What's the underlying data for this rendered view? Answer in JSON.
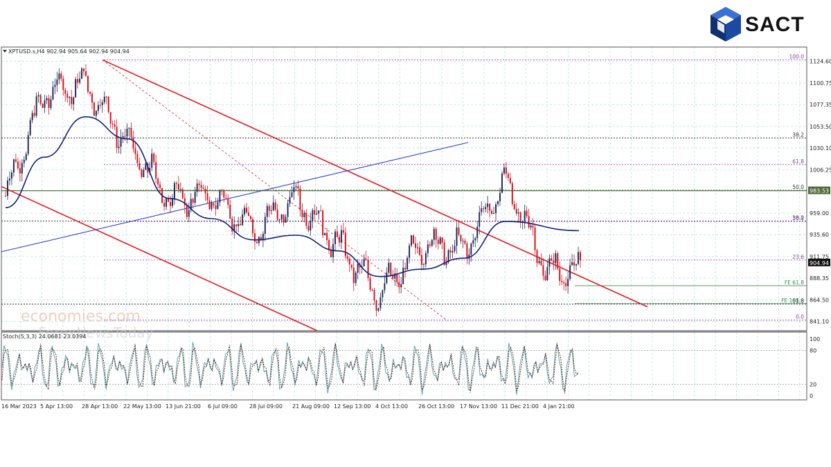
{
  "header": {
    "symbol_info": "XPTUSD.s,H4  902.94 905.64 902.94 904.94"
  },
  "brand": {
    "logo_text": "SACT",
    "logo_icon": "hexagon-cube-icon",
    "logo_color": "#1b4aa0"
  },
  "watermark": {
    "line1": "economies.com",
    "line2": "ForexNewsToday"
  },
  "indicator": {
    "label": "Stoch(5,3,3) 24.0681 23.0394"
  },
  "colors": {
    "channel": "#e8141c",
    "trendline": "#2b3fd1",
    "moving_average": "#0f1f7a",
    "fib_levels": "#b23fd4",
    "fe_levels": "#3d8a4a",
    "grid": "#b7e3e3",
    "candle_up": "#1f2a5a",
    "candle_down": "#d8121c",
    "stoch_main": "#3fa0a8",
    "stoch_signal": "#6a1010"
  },
  "chart_data": {
    "type": "line",
    "symbol": "XPTUSD.s",
    "timeframe": "H4",
    "last_price": 904.94,
    "highlight_price": 983.53,
    "y_ticks": [
      1124.6,
      1100.75,
      1077.35,
      1053.5,
      1030.1,
      1006.25,
      983.53,
      959.0,
      935.6,
      911.75,
      904.94,
      888.35,
      864.5,
      841.1
    ],
    "ylim": [
      831,
      1140
    ],
    "x_ticks": [
      "16 Mar 2023",
      "5 Apr 13:00",
      "28 Apr 13:00",
      "22 May 13:00",
      "13 Jun 21:00",
      "6 Jul 09:00",
      "28 Jul 09:00",
      "21 Aug 09:00",
      "12 Sep 13:00",
      "4 Oct 13:00",
      "26 Oct 13:00",
      "17 Nov 13:00",
      "11 Dec 21:00",
      "4 Jan 21:00"
    ],
    "fib_levels": [
      {
        "label": "100.0",
        "price": 1126.0
      },
      {
        "label": "38.2",
        "price": 1041.0
      },
      {
        "label": "61.8",
        "price": 1012.0
      },
      {
        "label": "50.0",
        "price": 984.0
      },
      {
        "label": "38.2",
        "price": 950.5
      },
      {
        "label": "50.0",
        "price": 950.0
      },
      {
        "label": "23.6",
        "price": 908.0
      },
      {
        "label": "61.8",
        "price": 860.0
      },
      {
        "label": "0.0",
        "price": 842.5
      }
    ],
    "fe_levels": [
      {
        "label": "FE 61.8",
        "price": 880.0
      },
      {
        "label": "FE 100.0",
        "price": 860.5
      }
    ],
    "series": [
      {
        "name": "XPTUSD.s",
        "x": [
          "16 Mar 2023",
          "5 Apr 13:00",
          "28 Apr 13:00",
          "22 May 13:00",
          "13 Jun 21:00",
          "6 Jul 09:00",
          "28 Jul 09:00",
          "21 Aug 09:00",
          "12 Sep 13:00",
          "4 Oct 13:00",
          "26 Oct 13:00",
          "17 Nov 13:00",
          "11 Dec 21:00",
          "4 Jan 21:00"
        ],
        "values": [
          978,
          1090,
          1100,
          1035,
          975,
          978,
          940,
          975,
          925,
          870,
          925,
          920,
          995,
          896
        ]
      },
      {
        "name": "Moving average",
        "x": [
          "16 Mar 2023",
          "5 Apr 13:00",
          "28 Apr 13:00",
          "22 May 13:00",
          "13 Jun 21:00",
          "6 Jul 09:00",
          "28 Jul 09:00",
          "21 Aug 09:00",
          "12 Sep 13:00",
          "4 Oct 13:00",
          "26 Oct 13:00",
          "17 Nov 13:00",
          "11 Dec 21:00",
          "4 Jan 21:00"
        ],
        "values": [
          965,
          1020,
          1064,
          1040,
          975,
          953,
          930,
          935,
          918,
          890,
          898,
          910,
          950,
          940
        ]
      }
    ],
    "stochastic": {
      "levels": [
        100,
        80,
        20,
        0
      ],
      "main": 24.0681,
      "signal": 23.0394
    }
  }
}
